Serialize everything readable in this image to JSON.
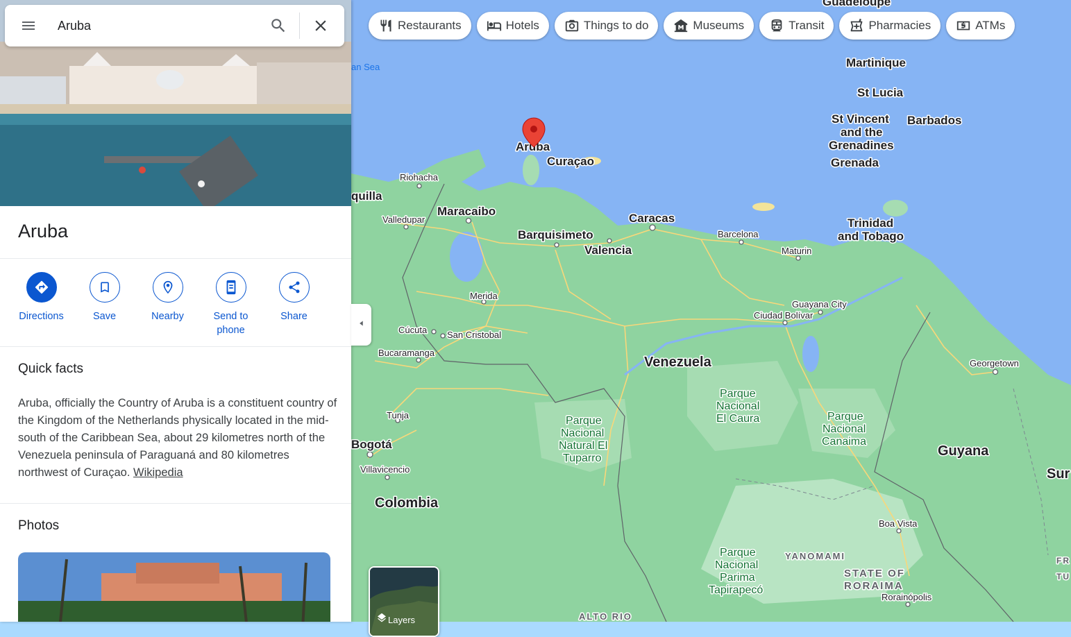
{
  "search": {
    "query": "Aruba"
  },
  "place": {
    "title": "Aruba"
  },
  "actions": [
    {
      "label": "Directions"
    },
    {
      "label": "Save"
    },
    {
      "label": "Nearby"
    },
    {
      "label": "Send to phone"
    },
    {
      "label": "Share"
    }
  ],
  "quick_facts": {
    "heading": "Quick facts",
    "text": "Aruba, officially the Country of Aruba is a constituent country of the Kingdom of the Netherlands physically located in the mid-south of the Caribbean Sea, about 29 kilometres north of the Venezuela peninsula of Paraguaná and 80 kilometres northwest of Curaçao.",
    "link": "Wikipedia"
  },
  "photos": {
    "heading": "Photos"
  },
  "chips": [
    {
      "label": "Restaurants",
      "icon": "restaurant-icon"
    },
    {
      "label": "Hotels",
      "icon": "hotel-icon"
    },
    {
      "label": "Things to do",
      "icon": "camera-icon"
    },
    {
      "label": "Museums",
      "icon": "museum-icon"
    },
    {
      "label": "Transit",
      "icon": "transit-icon"
    },
    {
      "label": "Pharmacies",
      "icon": "pharmacy-icon"
    },
    {
      "label": "ATMs",
      "icon": "atm-icon"
    }
  ],
  "layers": {
    "label": "Layers"
  },
  "map": {
    "marker_label": "Aruba",
    "labels": {
      "guadeloupe": "Guadeloupe",
      "martinique": "Martinique",
      "st_lucia": "St Lucia",
      "st_vincent_1": "St Vincent",
      "st_vincent_2": "and the",
      "st_vincent_3": "Grenadines",
      "barbados": "Barbados",
      "grenada": "Grenada",
      "trinidad_1": "Trinidad",
      "trinidad_2": "and Tobago",
      "curacao": "Curaçao",
      "caribbean_sea": "an Sea",
      "riohacha": "Riohacha",
      "barranquilla": "quilla",
      "maracaibo": "Maracaibo",
      "valledupar": "Valledupar",
      "barquisimeto": "Barquisimeto",
      "caracas": "Caracas",
      "valencia": "Valencia",
      "barcelona": "Barcelona",
      "maturin": "Maturin",
      "merida": "Merida",
      "guayana_city": "Guayana City",
      "ciudad_bolivar": "Ciudad Bolívar",
      "cucuta": "Cúcuta",
      "san_cristobal": "San Cristobal",
      "bucaramanga": "Bucaramanga",
      "venezuela": "Venezuela",
      "georgetown": "Georgetown",
      "tunja": "Tunja",
      "bogota": "Bogotá",
      "villavicencio": "Villavicencio",
      "colombia": "Colombia",
      "guyana": "Guyana",
      "suriname": "Sur",
      "el_caura_1": "Parque",
      "el_caura_2": "Nacional",
      "el_caura_3": "El Caura",
      "tuparro_1": "Parque",
      "tuparro_2": "Nacional",
      "tuparro_3": "Natural El",
      "tuparro_4": "Tuparro",
      "canaima_1": "Parque",
      "canaima_2": "Nacional",
      "canaima_3": "Canaima",
      "parima_1": "Parque",
      "parima_2": "Nacional",
      "parima_3": "Parima",
      "parima_4": "Tapirapecó",
      "yanomami": "YANOMAMI",
      "roraima_1": "STATE OF",
      "roraima_2": "RORAIMA",
      "boa_vista": "Boa Vista",
      "rorainopolis": "Rorainópolis",
      "alto_rio": "ALTO RIO",
      "tu": "TU",
      "fr": "FR"
    }
  },
  "colors": {
    "water": "#aadaff",
    "land": "#8fd19e",
    "accent_blue": "#0b57d0",
    "marker_red": "#ea4335",
    "road_yellow": "#f9d77a"
  }
}
